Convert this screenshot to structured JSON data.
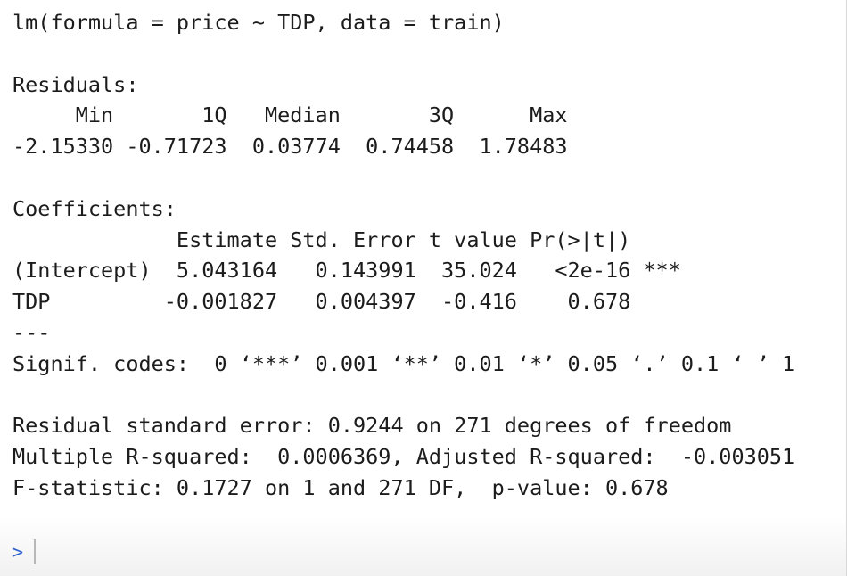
{
  "console": {
    "lines": [
      "lm(formula = price ~ TDP, data = train)",
      "",
      "Residuals:",
      "     Min       1Q   Median       3Q      Max ",
      "-2.15330 -0.71723  0.03774  0.74458  1.78483 ",
      "",
      "Coefficients:",
      "             Estimate Std. Error t value Pr(>|t|)    ",
      "(Intercept)  5.043164   0.143991  35.024   <2e-16 ***",
      "TDP         -0.001827   0.004397  -0.416    0.678    ",
      "---",
      "Signif. codes:  0 ‘***’ 0.001 ‘**’ 0.01 ‘*’ 0.05 ‘.’ 0.1 ‘ ’ 1",
      "",
      "Residual standard error: 0.9244 on 271 degrees of freedom",
      "Multiple R-squared:  0.0006369,\tAdjusted R-squared:  -0.003051 ",
      "F-statistic: 0.1727 on 1 and 271 DF,  p-value: 0.678"
    ],
    "prompt_symbol": ">"
  }
}
